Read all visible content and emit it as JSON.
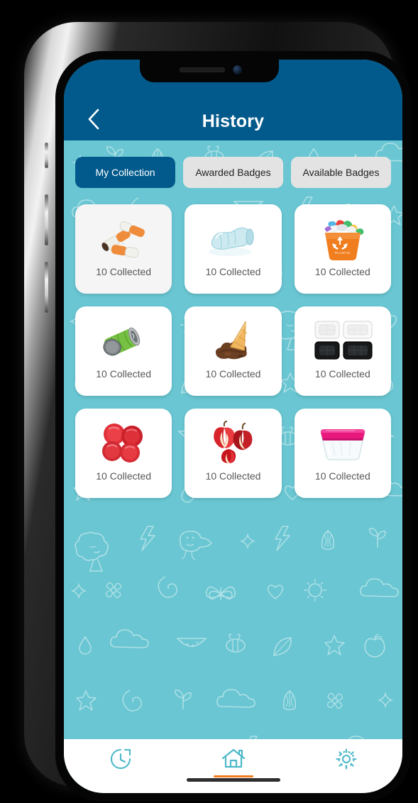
{
  "theme": {
    "header_blue": "#025a8c",
    "background_teal": "#69c6d2",
    "card_white": "#ffffff",
    "tab_inactive": "#e3e3e3",
    "accent_orange": "#f07d1e",
    "nav_icon_teal": "#4cb8c9",
    "label_gray": "#585858"
  },
  "header": {
    "title": "History",
    "back_icon": "chevron-left-icon"
  },
  "tabs": [
    {
      "label": "My Collection",
      "active": true
    },
    {
      "label": "Awarded Badges",
      "active": false
    },
    {
      "label": "Available Badges",
      "active": false
    }
  ],
  "collection": {
    "items": [
      {
        "art": "cigarette-butts-icon",
        "label": "10 Collected",
        "count": 10,
        "pressed": true
      },
      {
        "art": "plastic-bottle-icon",
        "label": "10 Collected",
        "count": 10,
        "pressed": false
      },
      {
        "art": "recycling-bin-icon",
        "label": "10 Collected",
        "count": 10,
        "pressed": false
      },
      {
        "art": "crushed-can-icon",
        "label": "10 Collected",
        "count": 10,
        "pressed": false
      },
      {
        "art": "ice-cream-cone-icon",
        "label": "10 Collected",
        "count": 10,
        "pressed": false
      },
      {
        "art": "food-trays-icon",
        "label": "10 Collected",
        "count": 10,
        "pressed": false
      },
      {
        "art": "bottle-caps-icon",
        "label": "10 Collected",
        "count": 10,
        "pressed": false
      },
      {
        "art": "apple-cores-icon",
        "label": "10 Collected",
        "count": 10,
        "pressed": false
      },
      {
        "art": "food-container-icon",
        "label": "10 Collected",
        "count": 10,
        "pressed": false
      }
    ]
  },
  "bottom_nav": [
    {
      "icon": "history-clock-icon",
      "active": false
    },
    {
      "icon": "home-icon",
      "active": true
    },
    {
      "icon": "settings-gear-icon",
      "active": false
    }
  ]
}
